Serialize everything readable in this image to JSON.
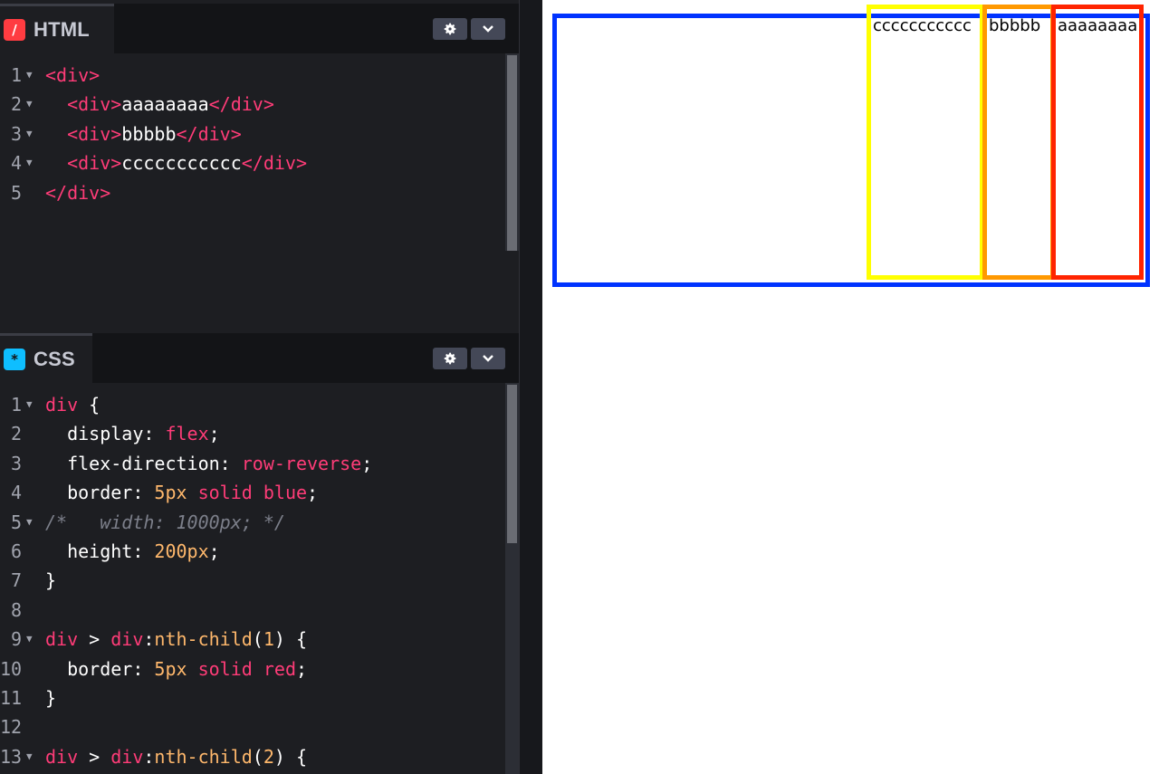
{
  "html_panel": {
    "title": "HTML",
    "icon_glyph": "/",
    "lines": [
      {
        "n": "1",
        "parts": [
          [
            "tag",
            "<div>"
          ]
        ]
      },
      {
        "n": "2",
        "parts": [
          [
            "tag",
            "  <div>"
          ],
          [
            "txt",
            "aaaaaaaa"
          ],
          [
            "tag",
            "</div>"
          ]
        ]
      },
      {
        "n": "3",
        "parts": [
          [
            "tag",
            "  <div>"
          ],
          [
            "txt",
            "bbbbb"
          ],
          [
            "tag",
            "</div>"
          ]
        ]
      },
      {
        "n": "4",
        "parts": [
          [
            "tag",
            "  <div>"
          ],
          [
            "txt",
            "ccccccccccc"
          ],
          [
            "tag",
            "</div>"
          ]
        ]
      },
      {
        "n": "5",
        "parts": [
          [
            "tag",
            "</div>"
          ]
        ]
      }
    ]
  },
  "css_panel": {
    "title": "CSS",
    "icon_glyph": "*",
    "lines": [
      {
        "n": "1",
        "parts": [
          [
            "tag",
            "div"
          ],
          [
            "pc",
            " {"
          ]
        ]
      },
      {
        "n": "2",
        "parts": [
          [
            "prop",
            "  display: "
          ],
          [
            "val",
            "flex"
          ],
          [
            "pc",
            ";"
          ]
        ]
      },
      {
        "n": "3",
        "parts": [
          [
            "prop",
            "  flex-direction: "
          ],
          [
            "val",
            "row-reverse"
          ],
          [
            "pc",
            ";"
          ]
        ]
      },
      {
        "n": "4",
        "parts": [
          [
            "prop",
            "  border: "
          ],
          [
            "num",
            "5px"
          ],
          [
            "pc",
            " "
          ],
          [
            "val",
            "solid"
          ],
          [
            "pc",
            " "
          ],
          [
            "val",
            "blue"
          ],
          [
            "pc",
            ";"
          ]
        ]
      },
      {
        "n": "5",
        "parts": [
          [
            "cm",
            "/*   width: 1000px; */"
          ]
        ]
      },
      {
        "n": "6",
        "parts": [
          [
            "prop",
            "  height: "
          ],
          [
            "num",
            "200px"
          ],
          [
            "pc",
            ";"
          ]
        ]
      },
      {
        "n": "7",
        "parts": [
          [
            "pc",
            "}"
          ]
        ]
      },
      {
        "n": "8",
        "parts": []
      },
      {
        "n": "9",
        "parts": [
          [
            "tag",
            "div"
          ],
          [
            "pc",
            " > "
          ],
          [
            "tag",
            "div"
          ],
          [
            "pc",
            ":"
          ],
          [
            "num",
            "nth-child"
          ],
          [
            "pc",
            "("
          ],
          [
            "num",
            "1"
          ],
          [
            "pc",
            ") {"
          ]
        ]
      },
      {
        "n": "10",
        "parts": [
          [
            "prop",
            "  border: "
          ],
          [
            "num",
            "5px"
          ],
          [
            "pc",
            " "
          ],
          [
            "val",
            "solid"
          ],
          [
            "pc",
            " "
          ],
          [
            "val",
            "red"
          ],
          [
            "pc",
            ";"
          ]
        ]
      },
      {
        "n": "11",
        "parts": [
          [
            "pc",
            "}"
          ]
        ]
      },
      {
        "n": "12",
        "parts": []
      },
      {
        "n": "13",
        "parts": [
          [
            "tag",
            "div"
          ],
          [
            "pc",
            " > "
          ],
          [
            "tag",
            "div"
          ],
          [
            "pc",
            ":"
          ],
          [
            "num",
            "nth-child"
          ],
          [
            "pc",
            "("
          ],
          [
            "num",
            "2"
          ],
          [
            "pc",
            ") {"
          ]
        ]
      }
    ]
  },
  "icons": {
    "settings": "gear-icon",
    "collapse": "chevron-down-icon"
  },
  "preview": {
    "child_a": "aaaaaaaa",
    "child_b": "bbbbb",
    "child_c": "ccccccccccc",
    "outer_border_color": "#0033ff",
    "child_a_border_color": "#ff2400",
    "child_b_border_color": "#ff9900",
    "child_c_border_color": "#ffff00"
  }
}
